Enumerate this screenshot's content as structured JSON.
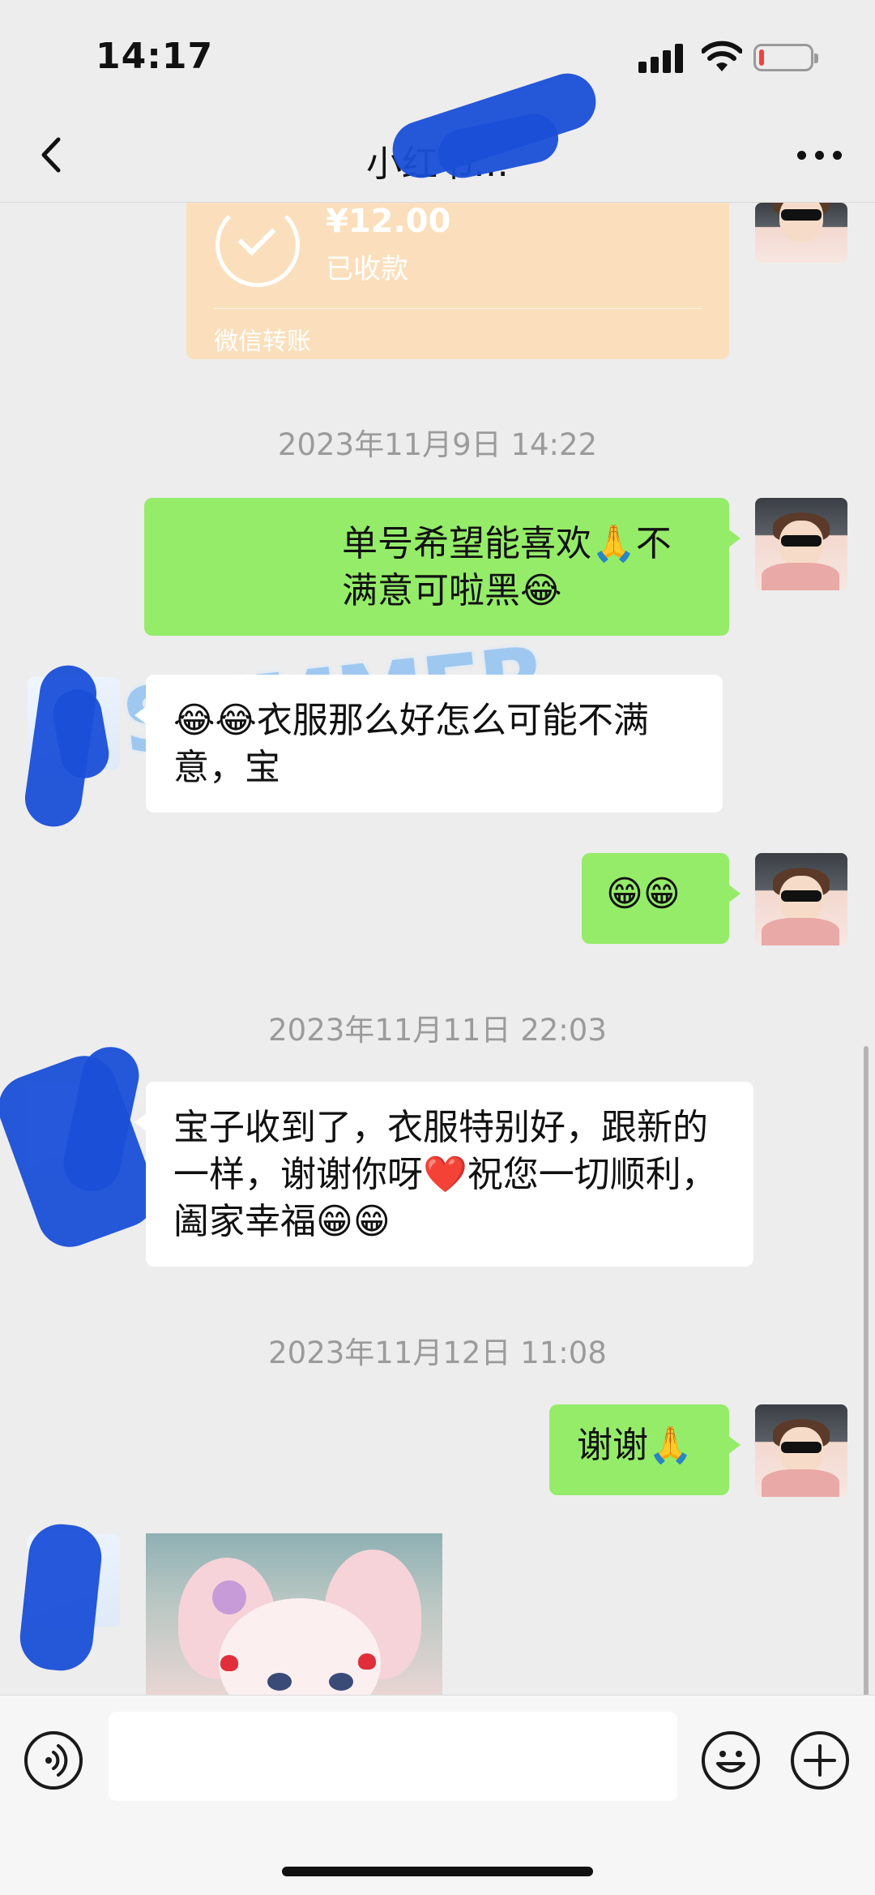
{
  "status_bar": {
    "time": "14:17",
    "battery_level": 0.1
  },
  "nav": {
    "title": "小红书…",
    "back_icon": "chevron-left-icon",
    "more_icon": "more-dots-icon"
  },
  "transfer": {
    "amount": "¥12.00",
    "status": "已收款",
    "footer": "微信转账"
  },
  "timestamps": [
    "2023年11月9日 14:22",
    "2023年11月11日 22:03",
    "2023年11月12日 11:08"
  ],
  "overlay_text": "SUMMER",
  "messages": [
    {
      "side": "right",
      "text": "单号希望能喜欢🙏不满意可啦黑😂"
    },
    {
      "side": "left",
      "text": "😂😂衣服那么好怎么可能不满意，宝"
    },
    {
      "side": "right",
      "text": "😁😁"
    },
    {
      "side": "left",
      "text": "宝子收到了，衣服特别好，跟新的一样，谢谢你呀❤️祝您一切顺利，阖家幸福😁😁"
    },
    {
      "side": "right",
      "text": "谢谢🙏"
    }
  ],
  "input": {
    "voice_icon": "voice-icon",
    "emoji_icon": "emoji-icon",
    "plus_icon": "plus-icon",
    "value": ""
  },
  "colors": {
    "green_bubble": "#95ec69",
    "background": "#ededed",
    "transfer_card": "#fbdfbc"
  }
}
